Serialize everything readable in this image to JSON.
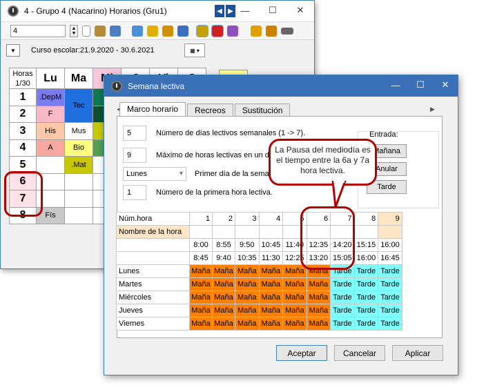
{
  "window1": {
    "title": "4 - Grupo 4 (Nacarino)  Horarios  (Gru1)",
    "class_combo": "4",
    "curso": "Curso escolar:21.9.2020 - 30.6.2021",
    "grid_header": "Horas\n1/30",
    "days": [
      "Lu",
      "Ma",
      "Mi",
      "J",
      "Vi",
      "S"
    ],
    "hours": [
      "1",
      "2",
      "3",
      "4",
      "5",
      "6",
      "7",
      "8"
    ],
    "lu": [
      ".DepM",
      "F",
      "His",
      "A",
      "",
      "",
      "",
      "Fís"
    ],
    "ma": [
      "Tec",
      "",
      "Mus",
      "Bio",
      ".Mat",
      "",
      "",
      ""
    ],
    "mi_partial": [
      "",
      "",
      ".M",
      "G",
      "",
      "",
      "",
      ""
    ]
  },
  "window2": {
    "title": "Semana lectiva",
    "tabs": [
      "Marco horario",
      "Recreos",
      "Sustitución"
    ],
    "fields": {
      "days_value": "5",
      "days_label": "Número de días lectivos semanales (1 -> 7).",
      "max_value": "9",
      "max_label": "Máximo de horas lectivas en un día",
      "first_day_value": "Lunes",
      "first_day_label": "Primer día de la semana",
      "first_hour_value": "1",
      "first_hour_label": "Número de la primera hora lectiva."
    },
    "entrada": {
      "label": "Entrada:",
      "buttons": [
        "Mañana",
        "Anular",
        "Tarde"
      ]
    },
    "callout": "La Pausa del mediodía es el tiempo entre la 6a y 7a hora lectiva.",
    "table": {
      "num_label": "Núm.hora",
      "name_label": "Nombre de la hora",
      "hour_numbers": [
        "1",
        "2",
        "3",
        "4",
        "5",
        "6",
        "7",
        "8",
        "9"
      ],
      "start_times": [
        "8:00",
        "8:55",
        "9:50",
        "10:45",
        "11:40",
        "12:35",
        "14:20",
        "15:15",
        "16:00"
      ],
      "end_times": [
        "8:45",
        "9:40",
        "10:35",
        "11:30",
        "12:25",
        "13:20",
        "15:05",
        "16:00",
        "16:45"
      ],
      "days": [
        "Lunes",
        "Martes",
        "Miércoles",
        "Jueves",
        "Viernes"
      ],
      "cell_values": [
        "Maña",
        "Maña",
        "Maña",
        "Maña",
        "Maña",
        "Maña",
        "Tarde",
        "Tarde",
        "Tarde"
      ]
    },
    "buttons": {
      "accept": "Aceptar",
      "cancel": "Cancelar",
      "apply": "Aplicar"
    }
  },
  "colors": {
    "morning": "#ff7f00",
    "afternoon": "#80ffff",
    "highlight": "#b00000",
    "titlebar_active": "#3a70b8"
  }
}
